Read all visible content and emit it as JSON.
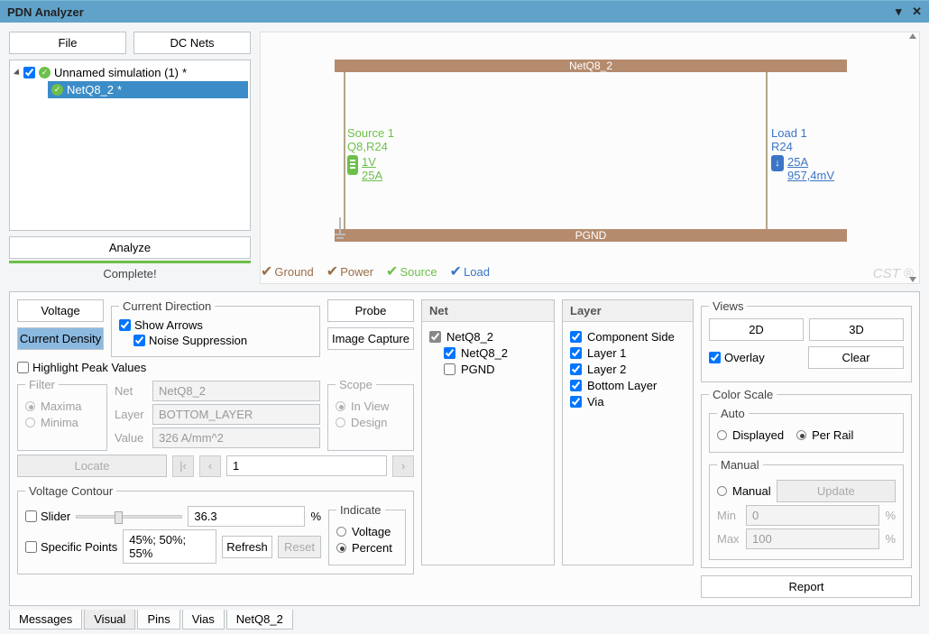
{
  "title": "PDN Analyzer",
  "left": {
    "file_btn": "File",
    "dcnets_btn": "DC Nets",
    "sim_name": "Unnamed simulation (1)",
    "net_name": "NetQ8_2",
    "analyze_btn": "Analyze",
    "complete": "Complete!"
  },
  "canvas": {
    "top_bus": "NetQ8_2",
    "bot_bus": "PGND",
    "source": {
      "title": "Source 1",
      "refs": "Q8,R24",
      "v": "1V",
      "i": "25A"
    },
    "load": {
      "title": "Load 1",
      "refs": "R24",
      "i": "25A",
      "v": "957,4mV"
    },
    "legend": {
      "g": "Ground",
      "p": "Power",
      "s": "Source",
      "l": "Load"
    }
  },
  "ctrl": {
    "voltage": "Voltage",
    "cd": "Current Density",
    "cdir": "Current Direction",
    "show_arrows": "Show Arrows",
    "noise": "Noise Suppression",
    "probe": "Probe",
    "capture": "Image Capture",
    "hpv": "Highlight Peak Values",
    "filter": "Filter",
    "maxima": "Maxima",
    "minima": "Minima",
    "net_lbl": "Net",
    "net_val": "NetQ8_2",
    "layer_lbl": "Layer",
    "layer_val": "BOTTOM_LAYER",
    "value_lbl": "Value",
    "value_val": "326 A/mm^2",
    "locate": "Locate",
    "step_val": "1",
    "scope": "Scope",
    "in_view": "In View",
    "design": "Design",
    "vc": "Voltage Contour",
    "slider": "Slider",
    "slider_val": "36.3",
    "pct": "%",
    "sp": "Specific Points",
    "sp_val": "45%; 50%; 55%",
    "refresh": "Refresh",
    "reset": "Reset",
    "indicate": "Indicate",
    "ind_v": "Voltage",
    "ind_p": "Percent"
  },
  "net_panel": {
    "hdr": "Net",
    "items": [
      "NetQ8_2",
      "NetQ8_2",
      "PGND"
    ]
  },
  "layer_panel": {
    "hdr": "Layer",
    "items": [
      "Component Side",
      "Layer 1",
      "Layer 2",
      "Bottom Layer",
      "Via"
    ]
  },
  "views": {
    "hdr": "Views",
    "b2d": "2D",
    "b3d": "3D",
    "overlay": "Overlay",
    "clear": "Clear",
    "cs": "Color Scale",
    "auto": "Auto",
    "displayed": "Displayed",
    "per_rail": "Per Rail",
    "manual": "Manual",
    "update": "Update",
    "min": "Min",
    "min_v": "0",
    "max": "Max",
    "max_v": "100",
    "pct": "%",
    "report": "Report"
  },
  "tabs": [
    "Messages",
    "Visual",
    "Pins",
    "Vias",
    "NetQ8_2"
  ]
}
